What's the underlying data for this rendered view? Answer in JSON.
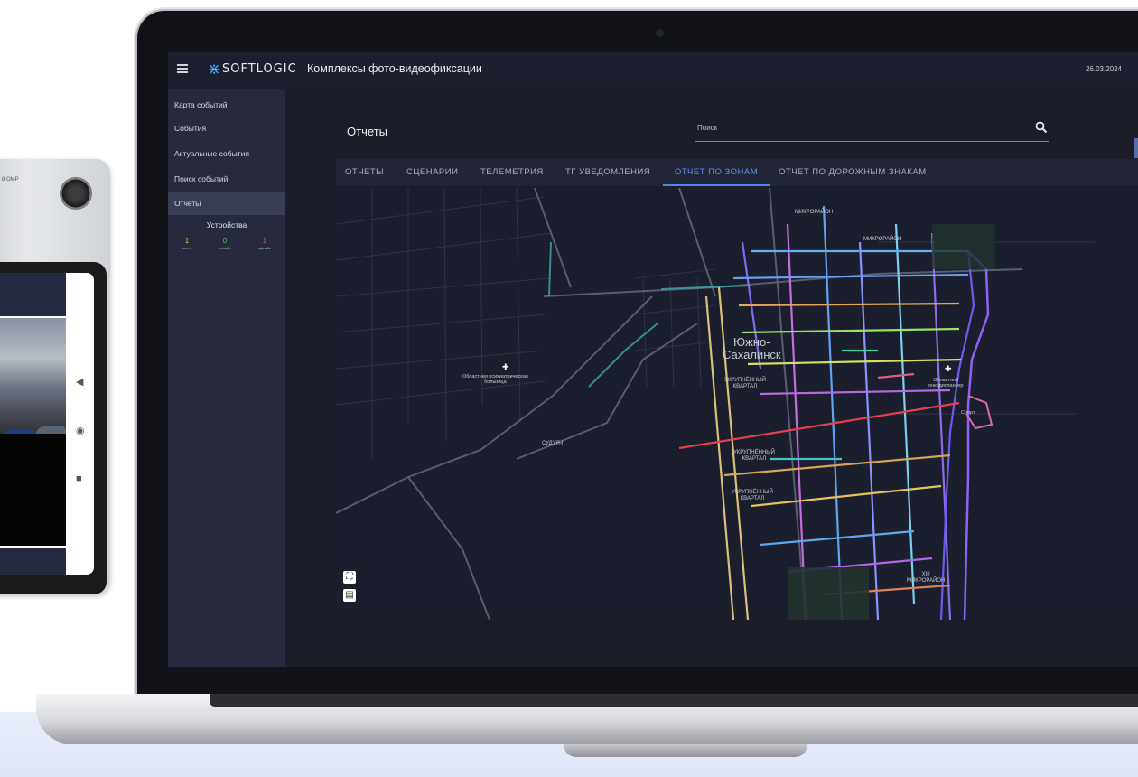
{
  "phone": {
    "camera_label": "8 OMP"
  },
  "header": {
    "logo": "SOFTLOGIC",
    "title": "Комплексы фото-видеофиксации",
    "date": "26.03.2024"
  },
  "sidebar": {
    "items": [
      {
        "label": "Карта событий"
      },
      {
        "label": "События"
      },
      {
        "label": "Актуальные события"
      },
      {
        "label": "Поиск событий"
      },
      {
        "label": "Отчеты"
      }
    ],
    "devices": {
      "title": "Устройства",
      "stats": [
        {
          "value": "1",
          "label": "всего",
          "color": "#e3c34a"
        },
        {
          "value": "0",
          "label": "онлайн",
          "color": "#4fc36a"
        },
        {
          "value": "1",
          "label": "офлайн",
          "color": "#e25b5b"
        }
      ]
    }
  },
  "main": {
    "page_title": "Отчеты",
    "search_placeholder": "Поиск",
    "tabs": [
      {
        "label": "ОТЧЕТЫ"
      },
      {
        "label": "СЦЕНАРИИ"
      },
      {
        "label": "ТЕЛЕМЕТРИЯ"
      },
      {
        "label": "ТГ УВЕДОМЛЕНИЯ"
      },
      {
        "label": "ОТЧЕТ ПО ЗОНАМ",
        "active": true
      },
      {
        "label": "ОТЧЕТ ПО ДОРОЖНЫМ ЗНАКАМ"
      }
    ]
  },
  "map": {
    "labels": {
      "city": "Южно-\nСахалинск",
      "district_top": "МИКРОРАЙОН",
      "district_2": "МИКРОРАЙОН",
      "kvartal_1": "УКРУПНЁННЫЙ\nКВАРТАЛ",
      "kvartal_2": "УКРУПНЁННЫЙ\nКВАРТАЛ",
      "kvartal_3": "УКРУПНЁННЫЙ\nКВАРТАЛ",
      "district_13": "XIII\nМИКРОРАЙОН",
      "hospital": "Областная психиатрическая\nбольница",
      "sudr": "СУДУЯ-I",
      "oblast": "Областной\nонкодиспансер",
      "sport": "Спорт"
    }
  },
  "colors": {
    "accent": "#4f86ea",
    "sidebar_bg": "#262a3c",
    "map_bg": "#1b1e2c"
  }
}
